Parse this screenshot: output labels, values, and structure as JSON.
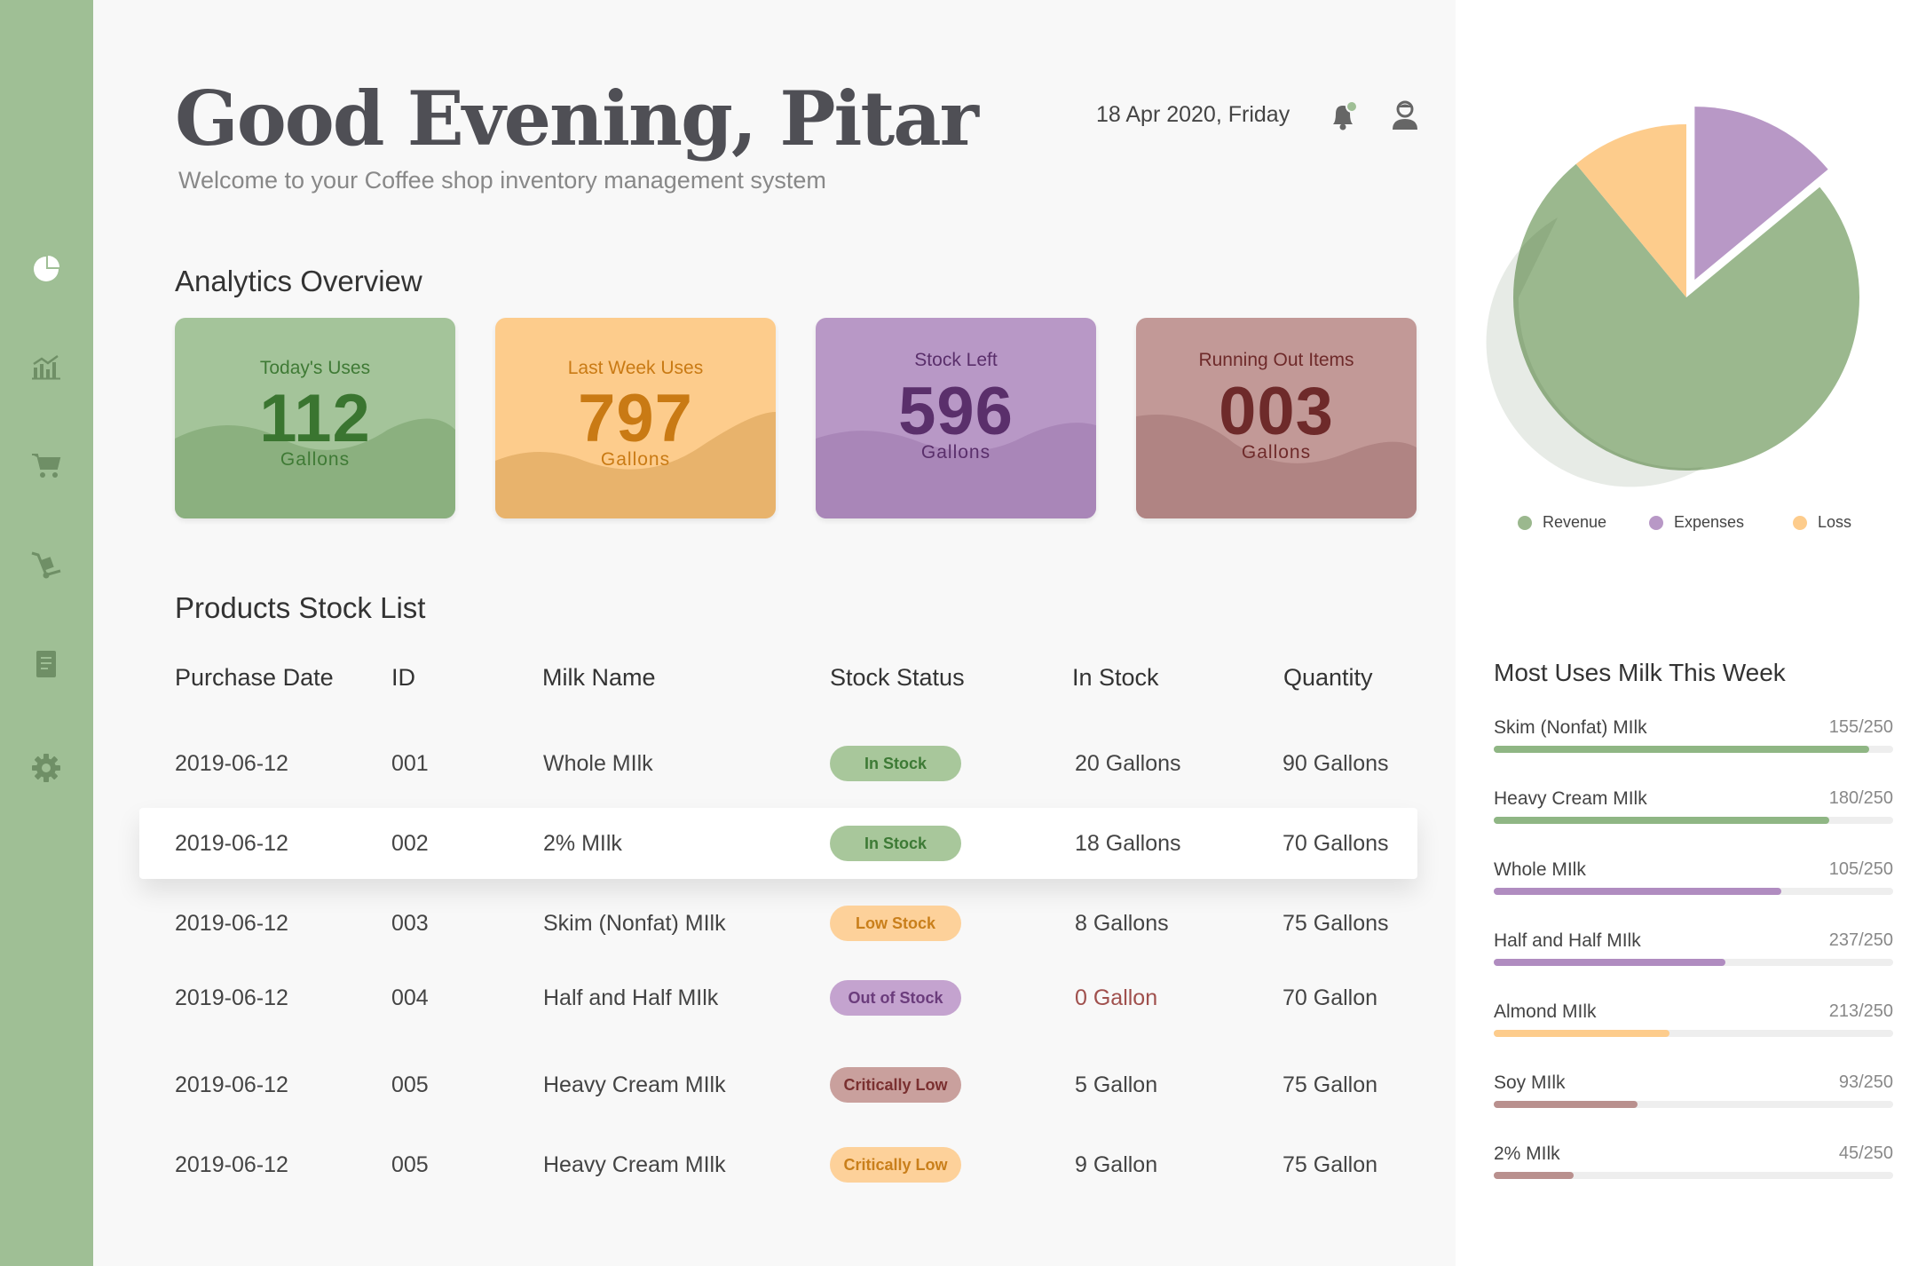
{
  "header": {
    "greeting": "Good Evening, Pitar",
    "subtitle": "Welcome to your Coffee shop inventory management system",
    "date": "18 Apr 2020, Friday"
  },
  "colors": {
    "green": "#9fbf95",
    "orange": "#fdcc8c",
    "purple": "#b898c6",
    "rose": "#c29997"
  },
  "sidebar": {
    "items": [
      {
        "icon": "pie-chart-icon"
      },
      {
        "icon": "bar-chart-icon"
      },
      {
        "icon": "cart-icon"
      },
      {
        "icon": "hand-truck-icon"
      },
      {
        "icon": "receipt-icon"
      },
      {
        "icon": "gear-icon"
      }
    ]
  },
  "analytics": {
    "title": "Analytics Overview",
    "cards": [
      {
        "label": "Today's Uses",
        "value": "112",
        "unit": "Gallons"
      },
      {
        "label": "Last Week Uses",
        "value": "797",
        "unit": "Gallons"
      },
      {
        "label": "Stock Left",
        "value": "596",
        "unit": "Gallons"
      },
      {
        "label": "Running Out Items",
        "value": "003",
        "unit": "Gallons"
      }
    ]
  },
  "stock": {
    "title": "Products Stock List",
    "columns": [
      "Purchase Date",
      "ID",
      "Milk Name",
      "Stock Status",
      "In Stock",
      "Quantity"
    ],
    "rows": [
      {
        "date": "2019-06-12",
        "id": "001",
        "name": "Whole MIlk",
        "status": "In Stock",
        "in_stock": "20 Gallons",
        "quantity": "90 Gallons"
      },
      {
        "date": "2019-06-12",
        "id": "002",
        "name": "2% MIlk",
        "status": "In Stock",
        "in_stock": "18 Gallons",
        "quantity": "70 Gallons"
      },
      {
        "date": "2019-06-12",
        "id": "003",
        "name": "Skim (Nonfat) MIlk",
        "status": "Low Stock",
        "in_stock": "8 Gallons",
        "quantity": "75 Gallons"
      },
      {
        "date": "2019-06-12",
        "id": "004",
        "name": "Half and Half MIlk",
        "status": "Out of Stock",
        "in_stock": "0 Gallon",
        "quantity": "70 Gallon"
      },
      {
        "date": "2019-06-12",
        "id": "005",
        "name": "Heavy Cream MIlk",
        "status": "Critically Low",
        "in_stock": "5 Gallon",
        "quantity": "75 Gallon"
      },
      {
        "date": "2019-06-12",
        "id": "005",
        "name": "Heavy Cream MIlk",
        "status": "Critically Low",
        "in_stock": "9 Gallon",
        "quantity": "75 Gallon"
      }
    ]
  },
  "chart_data": {
    "type": "pie",
    "categories": [
      "Revenue",
      "Expenses",
      "Loss"
    ],
    "values": [
      75,
      14,
      11
    ],
    "legend_position": "bottom",
    "colors": [
      "#9bb88e",
      "#b898c6",
      "#fdcc8c"
    ]
  },
  "milk_usage": {
    "title": "Most Uses Milk This Week",
    "items": [
      {
        "name": "Skim (Nonfat) MIlk",
        "count": "155/250",
        "fill": 0.94,
        "color": "#8fb684"
      },
      {
        "name": "Heavy Cream MIlk",
        "count": "180/250",
        "fill": 0.84,
        "color": "#8fb684"
      },
      {
        "name": "Whole MIlk",
        "count": "105/250",
        "fill": 0.72,
        "color": "#b08cc0"
      },
      {
        "name": "Half and Half MIlk",
        "count": "237/250",
        "fill": 0.58,
        "color": "#b08cc0"
      },
      {
        "name": "Almond MIlk",
        "count": "213/250",
        "fill": 0.44,
        "color": "#fdcc8c"
      },
      {
        "name": "Soy MIlk",
        "count": "93/250",
        "fill": 0.36,
        "color": "#b9908e"
      },
      {
        "name": "2% MIlk",
        "count": "45/250",
        "fill": 0.2,
        "color": "#b9908e"
      }
    ]
  }
}
